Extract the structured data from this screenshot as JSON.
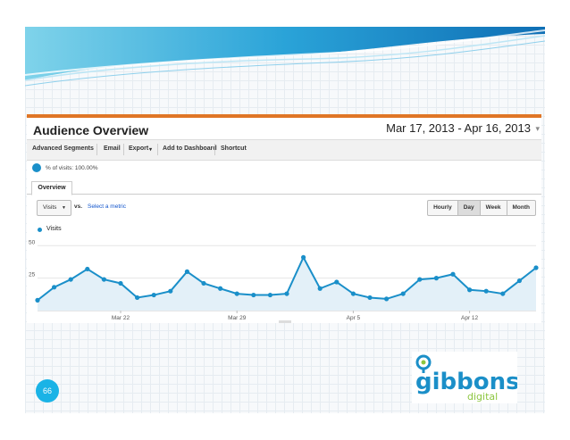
{
  "report": {
    "title": "Audience Overview",
    "date_range": "Mar 17, 2013 - Apr 16, 2013",
    "toolbar": [
      "Advanced Segments",
      "Email",
      "Export",
      "Add to Dashboard",
      "Shortcut"
    ],
    "export_chevron": "▾",
    "segment_label": "% of visits: 100.00%",
    "tab": "Overview",
    "metric_select": "Visits",
    "vs_label": "vs.",
    "select_metric_link": "Select a metric",
    "granularity": [
      "Hourly",
      "Day",
      "Week",
      "Month"
    ],
    "granularity_active": "Day",
    "legend": "Visits",
    "colors": {
      "series": "#1a8fc9",
      "fill": "#e3f0f8",
      "header_accent": "#e07626"
    }
  },
  "chart_data": {
    "type": "area",
    "series": [
      {
        "name": "Visits",
        "values": [
          8,
          18,
          24,
          32,
          24,
          21,
          10,
          12,
          15,
          30,
          21,
          17,
          13,
          12,
          12,
          13,
          41,
          17,
          22,
          13,
          10,
          9,
          13,
          24,
          25,
          28,
          16,
          15,
          13,
          23,
          33
        ]
      }
    ],
    "x_tick_labels": [
      "Mar 22",
      "Mar 29",
      "Apr 5",
      "Apr 12"
    ],
    "x_tick_indices": [
      5,
      12,
      19,
      26
    ],
    "y_tick_labels": [
      "50",
      "25"
    ],
    "y_tick_values": [
      50,
      25
    ],
    "ylim": [
      0,
      55
    ],
    "grid": true
  },
  "slide": {
    "page_number": "66",
    "logo_text_main": "gibbons",
    "logo_text_sub": "digital"
  }
}
